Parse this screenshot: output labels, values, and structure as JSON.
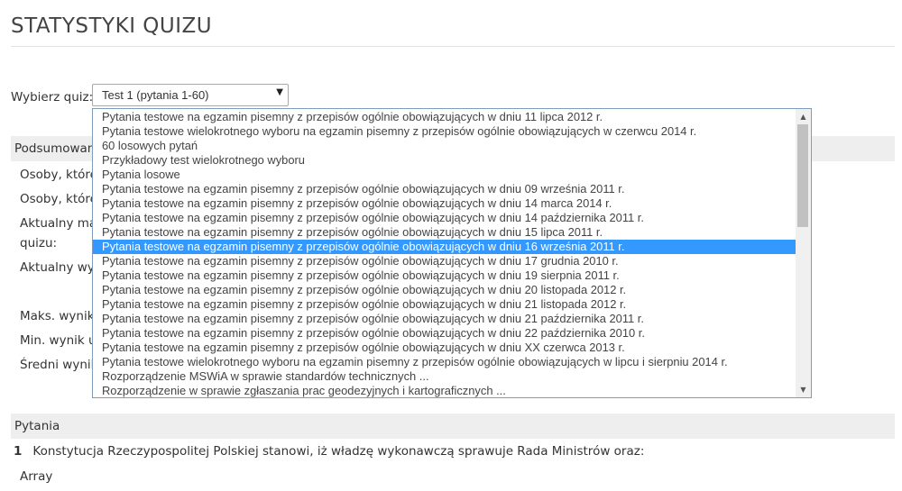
{
  "page": {
    "title": "STATYSTYKI QUIZU"
  },
  "quiz_select": {
    "label": "Wybierz quiz:",
    "selected": "Test 1 (pytania 1-60)",
    "arrow_icon": "▼"
  },
  "summary": {
    "heading": "Podsumowanie",
    "rows": [
      "Osoby, które",
      "Osoby, które",
      "Aktualny ma",
      "quizu:",
      "Aktualny wyn",
      "Maks. wynik",
      "Min. wynik u",
      "Średni wynik"
    ]
  },
  "dropdown": {
    "options": [
      "Pytania testowe na egzamin pisemny z przepisów ogólnie obowiązujących w dniu 11 lipca 2012 r.",
      "Pytania testowe wielokrotnego wyboru na egzamin pisemny z przepisów ogólnie obowiązujących w czerwcu 2014 r.",
      "60 losowych pytań",
      "Przykładowy test wielokrotnego wyboru",
      "Pytania losowe",
      "Pytania testowe na egzamin pisemny z przepisów ogólnie obowiązujących w dniu 09 września 2011 r.",
      "Pytania testowe na egzamin pisemny z przepisów ogólnie obowiązujących w dniu 14 marca 2014 r.",
      "Pytania testowe na egzamin pisemny z przepisów ogólnie obowiązujących w dniu 14 października 2011 r.",
      "Pytania testowe na egzamin pisemny z przepisów ogólnie obowiązujących w dniu 15 lipca 2011 r.",
      "Pytania testowe na egzamin pisemny z przepisów ogólnie obowiązujących w dniu 16 września 2011 r.",
      "Pytania testowe na egzamin pisemny z przepisów ogólnie obowiązujących w dniu 17 grudnia 2010 r.",
      "Pytania testowe na egzamin pisemny z przepisów ogólnie obowiązujących w dniu 19 sierpnia 2011 r.",
      "Pytania testowe na egzamin pisemny z przepisów ogólnie obowiązujących w dniu 20 listopada 2012 r.",
      "Pytania testowe na egzamin pisemny z przepisów ogólnie obowiązujących w dniu 21 listopada 2012 r.",
      "Pytania testowe na egzamin pisemny z przepisów ogólnie obowiązujących w dniu 21 października 2011 r.",
      "Pytania testowe na egzamin pisemny z przepisów ogólnie obowiązujących w dniu 22 października 2010 r.",
      "Pytania testowe na egzamin pisemny z przepisów ogólnie obowiązujących w dniu XX czerwca 2013 r.",
      "Pytania testowe wielokrotnego wyboru na egzamin pisemny z przepisów ogólnie obowiązujących w lipcu i sierpniu 2014 r.",
      "Rozporządzenie MSWiA w sprawie standardów technicznych ...",
      "Rozporządzenie w sprawie zgłaszania prac geodezyjnych i kartograficznych ..."
    ],
    "highlighted_index": 9,
    "scroll_up_icon": "▲",
    "scroll_down_icon": "▼"
  },
  "questions": {
    "heading": "Pytania",
    "items": [
      {
        "number": "1",
        "text": "Konstytucja Rzeczypospolitej Polskiej stanowi, iż władzę wykonawczą sprawuje Rada Ministrów oraz:",
        "answer": "Array"
      }
    ]
  },
  "colors": {
    "highlight": "#3399ff",
    "section_bar": "#eeeeee",
    "dropdown_border": "#7f9db9"
  }
}
